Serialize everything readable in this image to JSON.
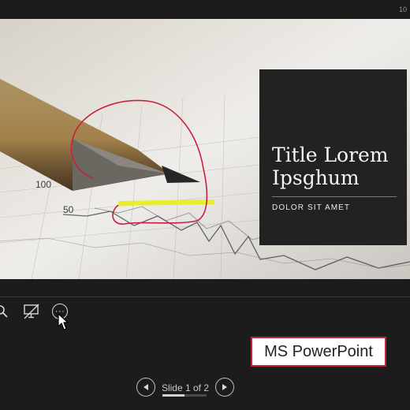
{
  "status": {
    "time": "10"
  },
  "slide": {
    "title": "Title Lorem\nIpsghum",
    "subtitle": "DOLOR SIT AMET",
    "chart_axis_labels": [
      "100",
      "50"
    ]
  },
  "toolbar": {
    "zoom_icon": "magnifier-icon",
    "screen_icon": "screen-off-icon",
    "more_icon": "more-options-icon",
    "more_glyph": "···"
  },
  "badge": {
    "label": "MS PowerPoint",
    "border_color": "#c5223f"
  },
  "navigation": {
    "slide_counter": "Slide 1 of 2",
    "current": 1,
    "total": 2,
    "progress": 0.5
  }
}
